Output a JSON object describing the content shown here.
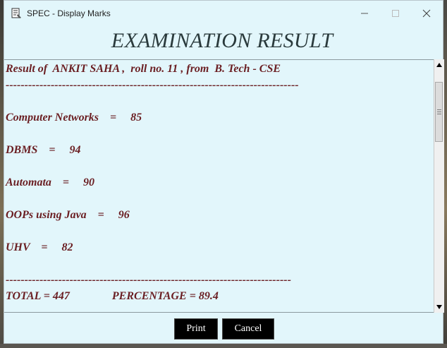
{
  "window": {
    "title": "SPEC - Display Marks",
    "app_icon": "document-icon",
    "controls": [
      "minimize-icon",
      "maximize-icon",
      "close-icon"
    ]
  },
  "heading": "EXAMINATION RESULT",
  "result": {
    "intro": "Result of  ANKIT SAHA ,  roll no. 11 , from  B. Tech - CSE",
    "divider_top": "------------------------------------------------------------------------------",
    "subjects": [
      {
        "line": "Computer Networks    =     85"
      },
      {
        "line": "DBMS    =     94"
      },
      {
        "line": "Automata    =     90"
      },
      {
        "line": "OOPs using Java    =     96"
      },
      {
        "line": "UHV    =     82"
      }
    ],
    "divider_bottom": "----------------------------------------------------------------------------",
    "summary": "TOTAL = 447               PERCENTAGE = 89.4"
  },
  "buttons": {
    "print": "Print",
    "cancel": "Cancel"
  },
  "colors": {
    "window_bg": "#e2f6fb",
    "result_text": "#6a1e22",
    "heading_text": "#2a3a3c",
    "button_bg": "#000000",
    "button_text": "#ffffff"
  }
}
